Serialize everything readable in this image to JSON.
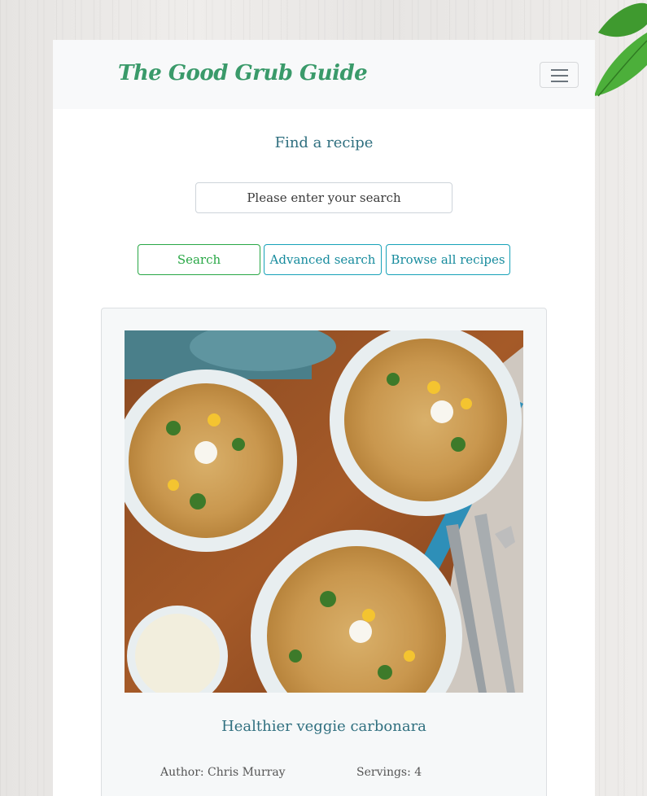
{
  "brand": "The Good Grub Guide",
  "search": {
    "heading": "Find a recipe",
    "placeholder": "Please enter your search"
  },
  "buttons": {
    "search": "Search",
    "advanced": "Advanced search",
    "browse": "Browse all recipes"
  },
  "recipe": {
    "title": "Healthier veggie carbonara",
    "author": "Author: Chris Murray",
    "servings": "Servings: 4"
  },
  "colors": {
    "brand": "#3a9a6a",
    "accent_teal": "#17a2b8",
    "accent_green": "#28a745",
    "heading": "#2f6f7f"
  },
  "icons": {
    "menu": "hamburger-menu-icon",
    "carousel_next": "chevron-right-icon"
  }
}
